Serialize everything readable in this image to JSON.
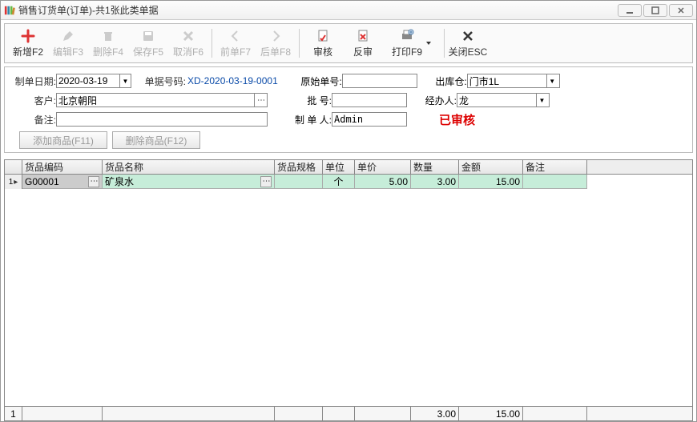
{
  "window": {
    "title": "销售订货单(订单)-共1张此类单据"
  },
  "toolbar": {
    "new": "新增F2",
    "edit": "编辑F3",
    "delete": "删除F4",
    "save": "保存F5",
    "cancel": "取消F6",
    "prev": "前单F7",
    "next": "后单F8",
    "audit": "审核",
    "unaudit": "反审",
    "print": "打印F9",
    "close": "关闭ESC"
  },
  "form": {
    "date_label": "制单日期:",
    "date_value": "2020-03-19",
    "docno_label": "单据号码:",
    "docno_value": "XD-2020-03-19-0001",
    "orig_label": "原始单号:",
    "orig_value": "",
    "wh_label": "出库仓:",
    "wh_value": "门市1L",
    "cust_label": "客户:",
    "cust_value": "北京朝阳",
    "batch_label": "批    号:",
    "batch_value": "",
    "handler_label": "经办人:",
    "handler_value": "龙",
    "remark_label": "备注:",
    "remark_value": "",
    "maker_label": "制 单 人:",
    "maker_value": "Admin",
    "approved_stamp": "已审核"
  },
  "buttons": {
    "add_item": "添加商品(F11)",
    "del_item": "删除商品(F12)"
  },
  "grid": {
    "headers": {
      "code": "货品编码",
      "name": "货品名称",
      "spec": "货品规格",
      "unit": "单位",
      "price": "单价",
      "qty": "数量",
      "amount": "金额",
      "remark": "备注"
    },
    "rows": [
      {
        "idx": "1",
        "code": "G00001",
        "name": "矿泉水",
        "spec": "",
        "unit": "个",
        "price": "5.00",
        "qty": "3.00",
        "amount": "15.00",
        "remark": ""
      }
    ],
    "footer": {
      "idx": "1",
      "qty": "3.00",
      "amount": "15.00"
    }
  }
}
